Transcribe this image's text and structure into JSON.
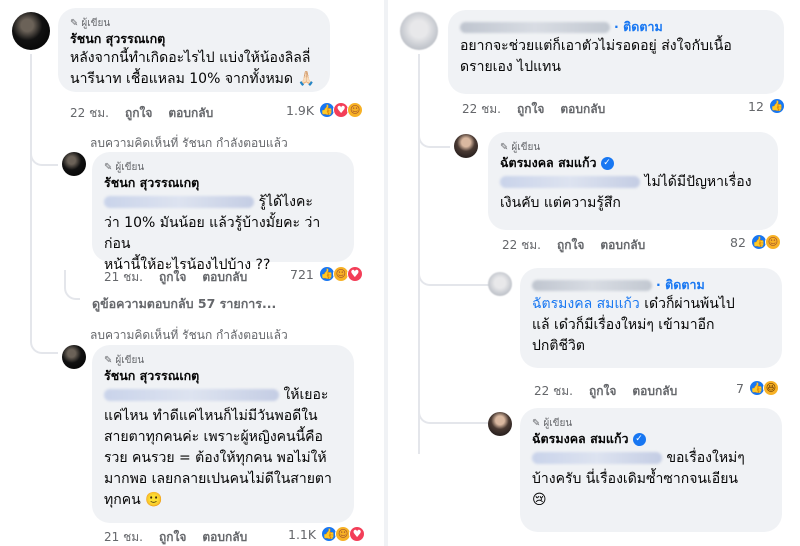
{
  "left": {
    "comment1": {
      "author_tag": "ผู้เขียน",
      "name": "รัชนก สุวรรณเกตุ",
      "text_lines": [
        "หลังจากนี้ทำเกิดอะไรไป แบ่งให้น้องลิลลี่",
        "นารีนาท เชื้อแหลม 10% จากทั้งหมด 🙏🏻"
      ],
      "time": "22 ชม.",
      "like": "ถูกใจ",
      "reply": "ตอบกลับ",
      "reaction_count": "1.9K"
    },
    "removed1": "ลบความคิดเห็นที่ รัชนก กำลังตอบแล้ว",
    "reply1": {
      "author_tag": "ผู้เขียน",
      "name": "รัชนก สุวรรณเกตุ",
      "line1_suffix": "รู้ได้ไงคะ",
      "line2": "ว่า 10% มันน้อย แล้วรู้บ้างมั้ยคะ ว่าก่อน",
      "line3": "หน้านี้ให้อะไรน้องไปบ้าง ??",
      "time": "21 ชม.",
      "like": "ถูกใจ",
      "reply": "ตอบกลับ",
      "reaction_count": "721"
    },
    "view_more": "ดูข้อความตอบกลับ 57 รายการ...",
    "removed2": "ลบความคิดเห็นที่ รัชนก กำลังตอบแล้ว",
    "reply2": {
      "author_tag": "ผู้เขียน",
      "name": "รัชนก สุวรรณเกตุ",
      "line1_suffix": "ให้เยอะ",
      "lines": [
        "แค่ไหน ทำดีแค่ไหนก็ไม่มีวันพอดีใน",
        "สายตาทุกคนค่ะ เพราะผู้หญิงคนนี้คือ",
        "รวย คนรวย = ต้องให้ทุกคน พอไม่ให้",
        "มากพอ เลยกลายเปนคนไม่ดีในสายตา",
        "ทุกคน 🙂"
      ],
      "time": "21 ชม.",
      "like": "ถูกใจ",
      "reply": "ตอบกลับ",
      "reaction_count": "1.1K"
    }
  },
  "right": {
    "comment1": {
      "follow": "· ติดตาม",
      "text_lines": [
        "อยากจะช่วยแต่ก็เอาตัวไม่รอดอยู่ ส่งใจกับเนื้อ",
        "ดรายเอง ไปแทน"
      ],
      "time": "22 ชม.",
      "like": "ถูกใจ",
      "reply": "ตอบกลับ",
      "reaction_count": "12"
    },
    "reply1": {
      "author_tag": "ผู้เขียน",
      "name": "ฉัตรมงคล สมแก้ว",
      "line1_suffix": "ไม่ได้มีปัญหาเรื่อง",
      "line2": "เงินคับ แต่ความรู้สึก",
      "time": "22 ชม.",
      "like": "ถูกใจ",
      "reply": "ตอบกลับ",
      "reaction_count": "82"
    },
    "reply2": {
      "follow": "· ติดตาม",
      "mention": "ฉัตรมงคล สมแก้ว",
      "line1_suffix": "เด๋วก็ผ่านพ้นไป",
      "line2": "แล้ เด๋วก็มีเรื่องใหม่ๆ เข้ามาอีก",
      "line3": "ปกติชีวิต",
      "time": "22 ชม.",
      "like": "ถูกใจ",
      "reply": "ตอบกลับ",
      "reaction_count": "7"
    },
    "reply3": {
      "author_tag": "ผู้เขียน",
      "name": "ฉัตรมงคล สมแก้ว",
      "line1_suffix": "ขอเรื่องใหม่ๆ",
      "line2": "บ้างครับ นี่เรื่องเดิมซ้ำซากจนเอียน",
      "line3": "😢"
    }
  }
}
